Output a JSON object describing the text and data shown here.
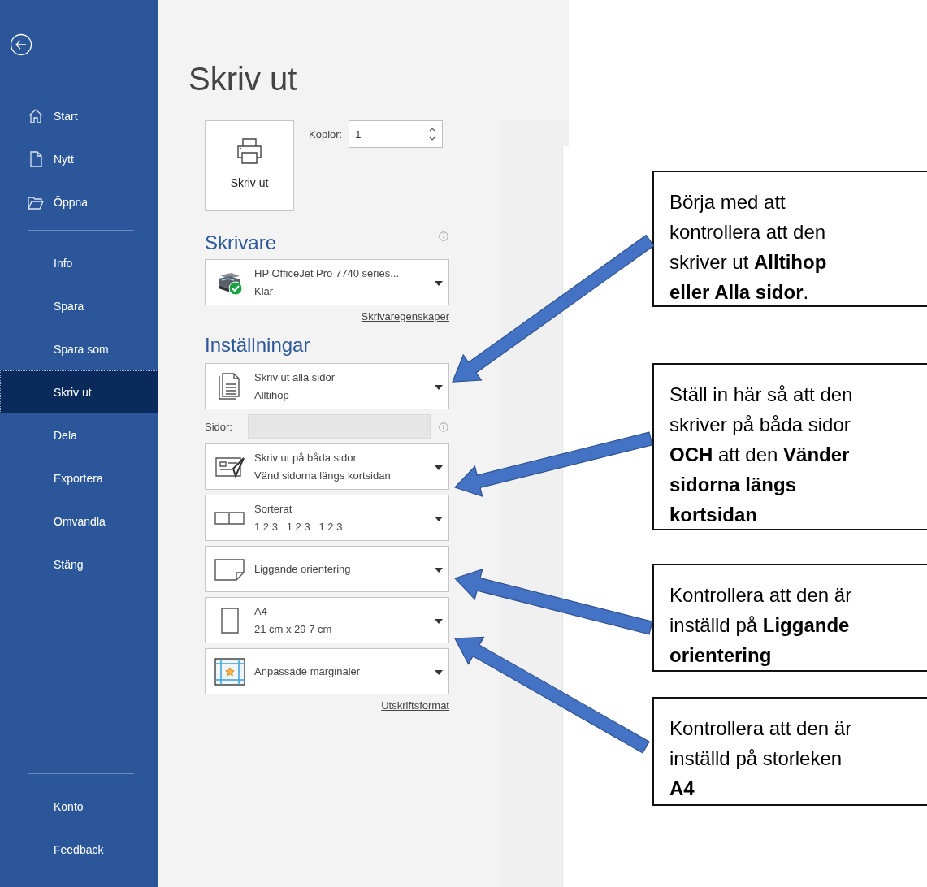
{
  "sidebar": {
    "groups": [
      {
        "items": [
          {
            "label": "Start",
            "selected": false
          },
          {
            "label": "Nytt",
            "selected": false
          },
          {
            "label": "Öppna",
            "selected": false
          }
        ]
      },
      {
        "items": [
          {
            "label": "Info",
            "selected": false
          },
          {
            "label": "Spara",
            "selected": false
          },
          {
            "label": "Spara som",
            "selected": false
          },
          {
            "label": "Skriv ut",
            "selected": true
          },
          {
            "label": "Dela",
            "selected": false
          },
          {
            "label": "Exportera",
            "selected": false
          },
          {
            "label": "Omvandla",
            "selected": false
          },
          {
            "label": "Stäng",
            "selected": false
          }
        ]
      },
      {
        "items": [
          {
            "label": "Konto",
            "selected": false
          },
          {
            "label": "Feedback",
            "selected": false
          }
        ]
      }
    ]
  },
  "print": {
    "title": "Skriv ut",
    "print_button": "Skriv ut",
    "copies": {
      "label": "Kopior:",
      "value": "1"
    },
    "printer": {
      "heading": "Skrivare",
      "name": "HP OfficeJet Pro 7740 series...",
      "status": "Klar",
      "link": "Skrivaregenskaper"
    },
    "settings": {
      "heading": "Inställningar",
      "pages_field": {
        "label": "Sidor:",
        "disabled": true
      },
      "dropdowns": [
        {
          "kind": "pages",
          "line1": "Skriv ut alla sidor",
          "line2": "Alltihop"
        },
        {
          "kind": "duplex",
          "line1": "Skriv ut på båda sidor",
          "line2": "Vänd sidorna längs kortsidan"
        },
        {
          "kind": "collate",
          "line1": "Sorterat",
          "line2": "1 2 3   1 2 3   1 2 3"
        },
        {
          "kind": "orientation",
          "line1": "Liggande orientering"
        },
        {
          "kind": "paper",
          "line1": "A4",
          "line2": "21 cm x 29 7 cm"
        },
        {
          "kind": "margins",
          "line1": "Anpassade marginaler"
        }
      ],
      "link": "Utskriftsformat"
    }
  },
  "callouts": [
    {
      "text": "Börja med att\nkontrollera att den\nskriver ut **Alltihop\neller Alla sidor**."
    },
    {
      "text": "Ställ in här så att den\nskriver på båda sidor\n**OCH** att den **Vänder\nsidorna längs\nkortsidan**"
    },
    {
      "text": "Kontrollera att den är\ninställd på **Liggande\norientering**"
    },
    {
      "text": "Kontrollera att den är\ninställd på storleken\n**A4**"
    }
  ]
}
